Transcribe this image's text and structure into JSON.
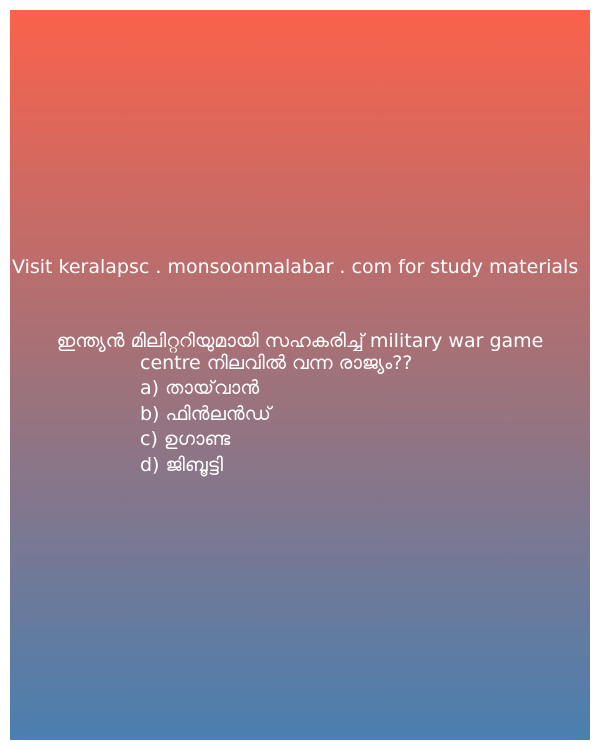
{
  "site_text": "Visit keralapsc . monsoonmalabar . com for study materials",
  "question": {
    "line1": "ഇന്ത്യൻ മിലിറ്ററിയുമായി സഹകരിച്ച് military war game",
    "line2": "centre നിലവിൽ വന്ന രാജ്യം??"
  },
  "options": [
    "a) തായ്‌വാൻ",
    "b) ഫിൻലൻഡ്",
    "c) ഉഗാണ്ട",
    "d) ജിബൂട്ടി"
  ],
  "colors": {
    "gradient_top": "#fb624b",
    "gradient_mid": "#a0727a",
    "gradient_bottom": "#4a7fb0",
    "text": "#ffffff"
  }
}
